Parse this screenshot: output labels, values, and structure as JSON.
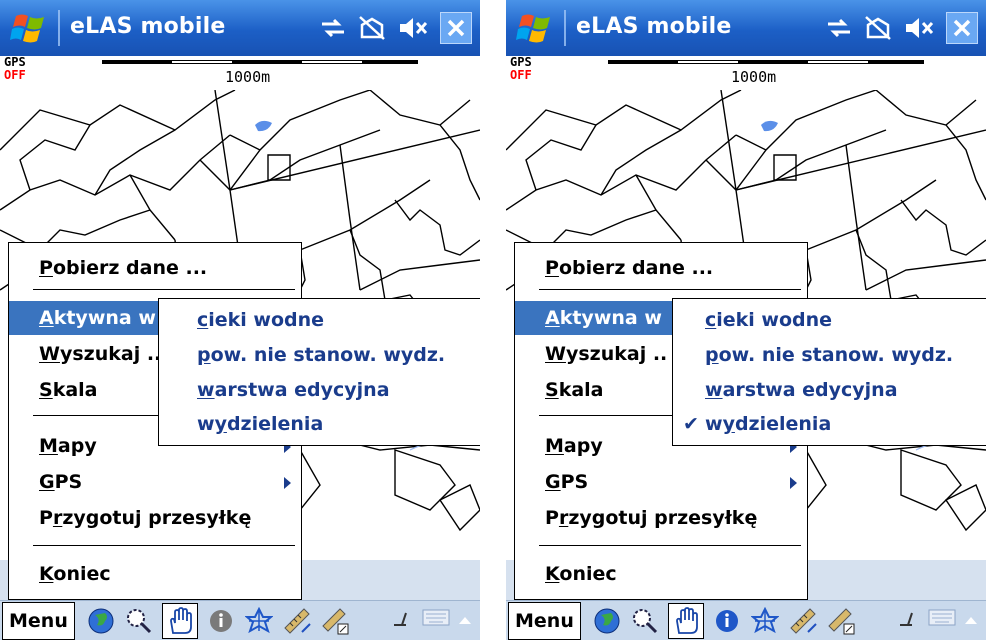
{
  "app": {
    "title": "eLAS mobile"
  },
  "status": {
    "gps_label": "GPS",
    "gps_state": "OFF",
    "scale_text": "1000m"
  },
  "colors": {
    "titlebar": "#1c5fc6",
    "menu_highlight": "#3a74bf",
    "submenu_text": "#1a3c8c",
    "gps_off": "#ff0000"
  },
  "menu": {
    "items": [
      {
        "label": "Pobierz dane ...",
        "u": "P"
      },
      {
        "label": "Aktywna w",
        "u": "A"
      },
      {
        "label": "Wyszukaj ..",
        "u": "W"
      },
      {
        "label": "Skala",
        "u": "S"
      },
      {
        "label": "Mapy",
        "u": "M"
      },
      {
        "label": "GPS",
        "u": "G"
      },
      {
        "label": "Przygotuj przesyłkę",
        "u": "r"
      },
      {
        "label": "Koniec",
        "u": "K"
      }
    ]
  },
  "submenu": {
    "items": [
      {
        "label": "cieki wodne",
        "u": "c"
      },
      {
        "label": "pow. nie stanow. wydz.",
        "u": "p"
      },
      {
        "label": "warstwa edycyjna",
        "u": "w"
      },
      {
        "label": "wydzielenia",
        "u": "y"
      }
    ],
    "checked_right": "✔"
  },
  "toolbar": {
    "menu_label": "Menu",
    "tools": [
      "globe-icon",
      "zoom-icon",
      "hand-icon",
      "info-icon",
      "gps-nav-icon",
      "ruler-icon",
      "edit-polygon-icon"
    ]
  }
}
